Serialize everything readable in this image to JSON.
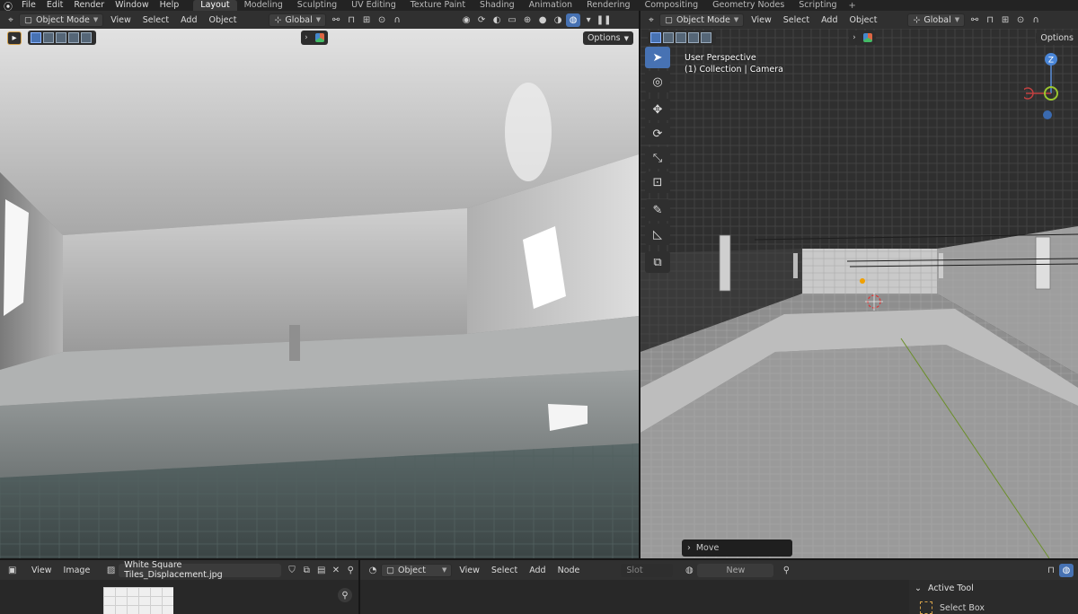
{
  "topbar": {
    "logo_icon": "blender-logo-icon",
    "menus": [
      "File",
      "Edit",
      "Render",
      "Window",
      "Help"
    ],
    "workspaces": [
      "Layout",
      "Modeling",
      "Sculpting",
      "UV Editing",
      "Texture Paint",
      "Shading",
      "Animation",
      "Rendering",
      "Compositing",
      "Geometry Nodes",
      "Scripting"
    ],
    "active_workspace": "Layout",
    "add_workspace": "+"
  },
  "left_viewport": {
    "mode": "Object Mode",
    "menus": [
      "View",
      "Select",
      "Add",
      "Object"
    ],
    "transform": "Global",
    "options_label": "Options",
    "shading_mode": "rendered"
  },
  "right_viewport": {
    "mode": "Object Mode",
    "menus": [
      "View",
      "Select",
      "Add",
      "Object"
    ],
    "transform": "Global",
    "options_label": "Options",
    "overlay_line1": "User Perspective",
    "overlay_line2": "(1) Collection | Camera",
    "last_operator": "Move",
    "gizmo_axis": "Z",
    "tools": [
      "select-box-icon",
      "cursor-icon",
      "move-icon",
      "rotate-icon",
      "scale-icon",
      "transform-icon",
      "annotate-icon",
      "measure-icon",
      "add-cube-icon"
    ]
  },
  "image_editor": {
    "menus": [
      "View",
      "Image"
    ],
    "image_name": "White Square Tiles_Displacement.jpg"
  },
  "shader_editor": {
    "object_type": "Object",
    "menus": [
      "View",
      "Select",
      "Add",
      "Node"
    ],
    "slot_label": "Slot",
    "new_label": "New"
  },
  "properties": {
    "section": "Active Tool",
    "tool": "Select Box"
  },
  "colors": {
    "accent": "#4772b3",
    "header": "#303030",
    "background": "#161616"
  }
}
